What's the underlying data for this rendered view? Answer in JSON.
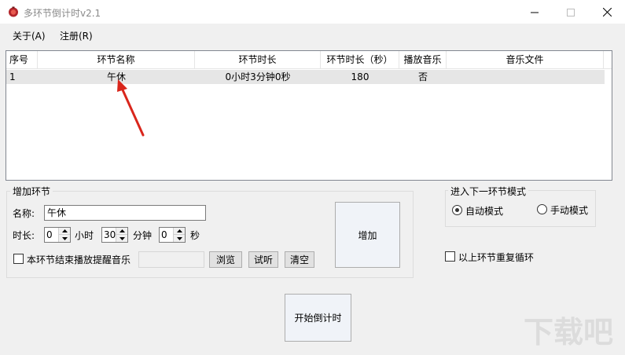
{
  "window": {
    "title": "多环节倒计时v2.1"
  },
  "menu": {
    "about": "关于(A)",
    "register": "注册(R)"
  },
  "table": {
    "headers": {
      "index": "序号",
      "name": "环节名称",
      "duration": "环节时长",
      "seconds": "环节时长（秒）",
      "play": "播放音乐",
      "file": "音乐文件"
    },
    "rows": [
      {
        "index": "1",
        "name": "午休",
        "duration": "0小时3分钟0秒",
        "seconds": "180",
        "play": "否",
        "file": ""
      }
    ]
  },
  "add_group": {
    "title": "增加环节",
    "name_label": "名称:",
    "name_value": "午休",
    "duration_label": "时长:",
    "hours_value": "0",
    "hours_unit": "小时",
    "minutes_value": "30",
    "minutes_unit": "分钟",
    "seconds_value": "0",
    "seconds_unit": "秒",
    "music_checkbox_label": "本环节结束播放提醒音乐",
    "browse_label": "浏览",
    "preview_label": "试听",
    "clear_label": "清空",
    "add_label": "增加"
  },
  "mode_group": {
    "title": "进入下一环节模式",
    "auto_label": "自动模式",
    "manual_label": "手动模式",
    "selected": "auto"
  },
  "loop_label": "以上环节重复循环",
  "start_label": "开始倒计时",
  "watermark_text": "下载吧",
  "colors": {
    "arrow": "#d9261c",
    "selection_row": "#e6e6e6"
  }
}
